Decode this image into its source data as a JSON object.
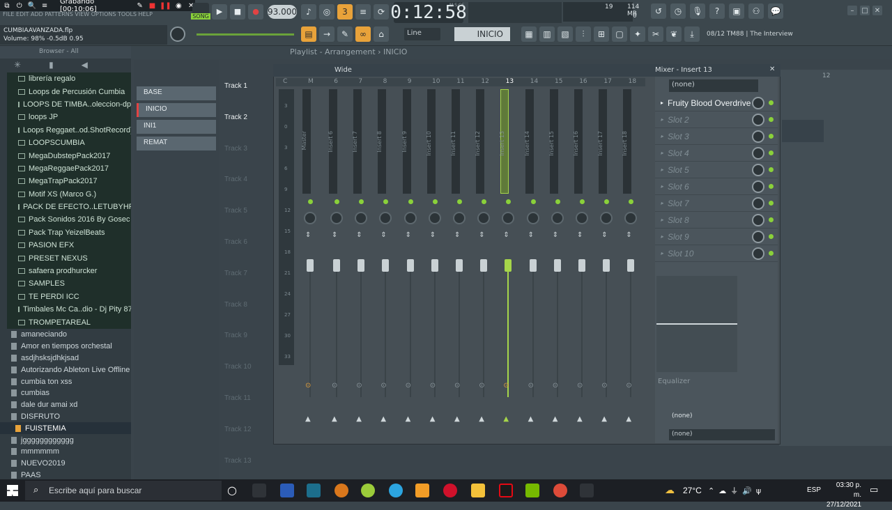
{
  "title_bar": {
    "menu": "FILE EDIT ADD PATTERNS VIEW OPTIONS TOOLS HELP",
    "recording": "Grabando [00:10:06]"
  },
  "project": {
    "file": "CUMBIAAVANZADA.flp",
    "volume": "Volume: 98%  -0.5dB  0.95"
  },
  "transport": {
    "song_label": "SONG",
    "tempo": "93.000",
    "time": "0:12:58",
    "time_unit": "M:S:CS",
    "cpu": "19",
    "mem": "114 MB",
    "mem2": "0"
  },
  "toolbar2": {
    "snap": "Line",
    "pattern": "INICIO",
    "news": "08/12  TM88 | The Interview"
  },
  "browser": {
    "header": "Browser - All",
    "folders": [
      "librería regalo",
      "Loops de Percusión Cumbia",
      "LOOPS DE TIMBA..oleccion-dp87",
      "loops JP",
      "Loops Reggaet..od.ShotRecord)",
      "LOOPSCUMBIA",
      "MegaDubstepPack2017",
      "MegaReggaePack2017",
      "MegaTrapPack2017",
      "Motif XS (Marco G.)",
      "PACK DE EFECTO..LETUBYHP TFM",
      "Pack Sonidos 2016 By Gosec",
      "Pack Trap YeizelBeats",
      "PASION EFX",
      "PRESET NEXUS",
      "safaera prodhurcker",
      "SAMPLES",
      "TE PERDI ICC",
      "Timbales Mc Ca..dio - Dj Pity 87",
      "TROMPETAREAL"
    ],
    "files": [
      "amaneciando",
      "Amor en tiempos orchestal",
      "asdjhsksjdhkjsad",
      "Autorizando Ableton Live Offline",
      "cumbia ton xss",
      "cumbias",
      "dale dur amai xd",
      "DISFRUTO",
      "FUISTEMIA",
      "jgggggggggggg",
      "mmmmmm",
      "NUEVO2019",
      "PAAS"
    ],
    "selected_file": "FUISTEMIA"
  },
  "patterns": [
    "BASE",
    "INICIO",
    "INI1",
    "REMAT"
  ],
  "playlist": {
    "breadcrumb": "Playlist - Arrangement › INICIO",
    "ruler_mark": "12",
    "tracks": [
      "Track 1",
      "Track 2",
      "Track 3",
      "Track 4",
      "Track 5",
      "Track 6",
      "Track 7",
      "Track 8",
      "Track 9",
      "Track 10",
      "Track 11",
      "Track 12",
      "Track 13"
    ]
  },
  "mixer": {
    "view": "Wide",
    "title": "Mixer - Insert 13",
    "headers": [
      "C",
      "M",
      "6",
      "7",
      "8",
      "9",
      "10",
      "11",
      "12",
      "13",
      "14",
      "15",
      "16",
      "17",
      "18"
    ],
    "strips": [
      "Master",
      "Insert 6",
      "Insert 7",
      "Insert 8",
      "Insert 9",
      "Insert 10",
      "Insert 11",
      "Insert 12",
      "Insert 13",
      "Insert 14",
      "Insert 15",
      "Insert 16",
      "Insert 17",
      "Insert 18"
    ],
    "selected": "Insert 13",
    "scale": [
      "3",
      "0",
      "3",
      "6",
      "9",
      "12",
      "15",
      "18",
      "21",
      "24",
      "27",
      "30",
      "33"
    ],
    "preset": "(none)",
    "slots": [
      "Fruity Blood Overdrive",
      "Slot 2",
      "Slot 3",
      "Slot 4",
      "Slot 5",
      "Slot 6",
      "Slot 7",
      "Slot 8",
      "Slot 9",
      "Slot 10"
    ],
    "eq_label": "Equalizer",
    "out_in": "(none)",
    "out_out": "(none)"
  },
  "taskbar": {
    "search": "Escribe aquí para buscar",
    "weather": "27°C",
    "lang": "ESP",
    "time": "03:30 p. m.",
    "date": "27/12/2021"
  }
}
